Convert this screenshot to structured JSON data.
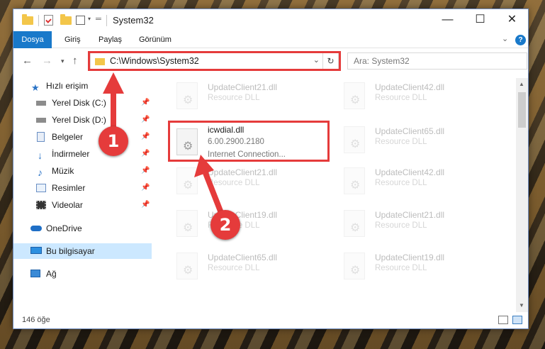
{
  "window": {
    "title": "System32",
    "controls": {
      "minimize": "—",
      "maximize": "☐",
      "close": "✕"
    }
  },
  "ribbon": {
    "tabs": [
      "Dosya",
      "Giriş",
      "Paylaş",
      "Görünüm"
    ],
    "help": "?"
  },
  "address": {
    "path": "C:\\Windows\\System32",
    "search_placeholder": "Ara: System32"
  },
  "sidebar": {
    "items": [
      {
        "label": "Hızlı erişim",
        "icon": "star-icon",
        "pinned": false
      },
      {
        "label": "Yerel Disk (C:)",
        "icon": "drive-icon",
        "pinned": true
      },
      {
        "label": "Yerel Disk (D:)",
        "icon": "drive-icon",
        "pinned": true
      },
      {
        "label": "Belgeler",
        "icon": "documents-icon",
        "pinned": true
      },
      {
        "label": "İndirmeler",
        "icon": "download-icon",
        "pinned": true
      },
      {
        "label": "Müzik",
        "icon": "music-icon",
        "pinned": true
      },
      {
        "label": "Resimler",
        "icon": "pictures-icon",
        "pinned": true
      },
      {
        "label": "Videolar",
        "icon": "videos-icon",
        "pinned": true
      },
      {
        "label": "OneDrive",
        "icon": "cloud-icon",
        "pinned": false
      },
      {
        "label": "Bu bilgisayar",
        "icon": "computer-icon",
        "pinned": false,
        "selected": true
      },
      {
        "label": "Ağ",
        "icon": "network-icon",
        "pinned": false
      }
    ]
  },
  "files": [
    {
      "name": "UpdateClient21.dll",
      "type": "Resource DLL"
    },
    {
      "name": "UpdateClient42.dll",
      "type": "Resource DLL"
    },
    {
      "name": "icwdial.dll",
      "version": "6.00.2900.2180",
      "description": "Internet Connection...",
      "highlighted": true
    },
    {
      "name": "UpdateClient65.dll",
      "type": "Resource DLL"
    },
    {
      "name": "UpdateClient21.dll",
      "type": "Resource DLL"
    },
    {
      "name": "UpdateClient42.dll",
      "type": "Resource DLL"
    },
    {
      "name": "UpdateClient19.dll",
      "type": "Resource DLL"
    },
    {
      "name": "UpdateClient21.dll",
      "type": "Resource DLL"
    },
    {
      "name": "UpdateClient65.dll",
      "type": "Resource DLL"
    },
    {
      "name": "UpdateClient19.dll",
      "type": "Resource DLL"
    }
  ],
  "status": {
    "item_count": "146 öğe"
  },
  "annotations": {
    "step1": "1",
    "step2": "2",
    "color": "#e53b3b"
  }
}
